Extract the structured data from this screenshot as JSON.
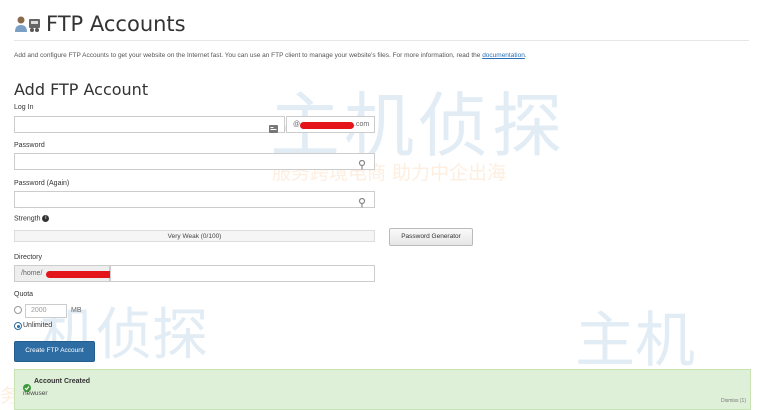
{
  "header": {
    "title": "FTP Accounts",
    "intro_text": "Add and configure FTP Accounts to get your website on the Internet fast. You can use an FTP client to manage your website's files. For more information, read the",
    "intro_link": "documentation",
    "intro_end": "."
  },
  "form": {
    "section_title": "Add FTP Account",
    "login_label": "Log In",
    "login_value": "",
    "domain_at": "@",
    "domain_suffix": ".com",
    "password_label": "Password",
    "password_again_label": "Password (Again)",
    "strength_label": "Strength",
    "strength_value": "Very Weak (0/100)",
    "password_generator_label": "Password Generator",
    "directory_label": "Directory",
    "directory_prefix": "/home/",
    "quota_label": "Quota",
    "quota_value": "2000",
    "quota_unit": "MB",
    "unlimited_label": "Unlimited",
    "unlimited_selected": true,
    "submit_label": "Create FTP Account"
  },
  "notification": {
    "title": "Account Created",
    "detail": "newuser",
    "dismiss": "Dismiss (1)"
  },
  "watermark": {
    "brand": "主机侦探",
    "slogan": "服务跨境电商 助力中企出海",
    "slogan_partial": "服务跨境电商",
    "slogan_left": "务跨境电商 助力中企出海",
    "brand_partial": "主机",
    "brand_left": "机侦探"
  },
  "colors": {
    "primary": "#2e6da4",
    "success_bg": "#dff0d8",
    "success_icon": "#3c9a3c",
    "redaction": "#e4141b",
    "link": "#2a6fb5"
  },
  "icons": [
    "ftp-accounts-icon",
    "id-card-icon",
    "key-icon",
    "info-icon",
    "check-circle-icon"
  ]
}
